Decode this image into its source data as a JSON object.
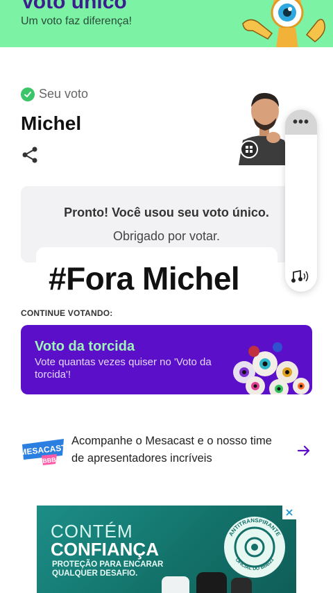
{
  "header": {
    "title": "Voto único",
    "subtitle": "Um voto faz diferença!"
  },
  "vote": {
    "label": "Seu voto",
    "candidate": "Michel"
  },
  "side_panel": {
    "more": "•••"
  },
  "confirmation": {
    "title": "Pronto! Você usou seu voto único.",
    "subtitle": "Obrigado por votar."
  },
  "overlay": {
    "text": "#Fora Michel"
  },
  "continue": {
    "label": "CONTINUE VOTANDO:"
  },
  "torcida": {
    "title": "Voto da torcida",
    "subtitle": "Vote quantas vezes quiser no 'Voto da torcida'!"
  },
  "mesacast": {
    "logo_line1": "MESACAST",
    "logo_line2": "BBB",
    "text": "Acompanhe o Mesacast e o nosso time de apresentadores incríveis"
  },
  "ad": {
    "line1": "CONTÉM",
    "line2": "CONFIANÇA",
    "line3": "PROTEÇÃO PARA ENCARAR QUALQUER DESAFIO.",
    "seal_top": "ANTITRANSPIRANTE",
    "seal_bottom": "OFICIAL DO BBB23"
  },
  "colors": {
    "header_bg": "#7cf3a4",
    "brand_purple": "#5b0fc8",
    "check_green": "#3bc46a",
    "ad_bg": "#127068"
  },
  "icons": [
    "check-icon",
    "share-icon",
    "more-icon",
    "sound-icon",
    "arrow-right-icon",
    "close-icon"
  ]
}
